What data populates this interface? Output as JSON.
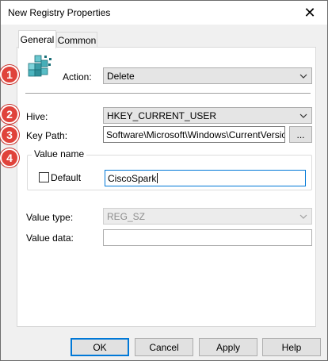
{
  "window": {
    "title": "New Registry Properties",
    "close_glyph": "✕"
  },
  "tabs": [
    {
      "label": "General",
      "active": true
    },
    {
      "label": "Common",
      "active": false
    }
  ],
  "general": {
    "icon": "registry-cubes-icon",
    "action_label": "Action:",
    "action_value": "Delete",
    "hive_label": "Hive:",
    "hive_value": "HKEY_CURRENT_USER",
    "key_path_label": "Key Path:",
    "key_path_value": "Software\\Microsoft\\Windows\\CurrentVersion\\R",
    "browse_label": "...",
    "value_name_group": "Value name",
    "default_checkbox_label": "Default",
    "default_checked": false,
    "value_name_value": "CiscoSpark",
    "value_type_label": "Value type:",
    "value_type_value": "REG_SZ",
    "value_data_label": "Value data:",
    "value_data_value": ""
  },
  "annotations": [
    "1",
    "2",
    "3",
    "4"
  ],
  "annotation_color": "#e0433b",
  "buttons": {
    "ok": "OK",
    "cancel": "Cancel",
    "apply": "Apply",
    "help": "Help"
  }
}
